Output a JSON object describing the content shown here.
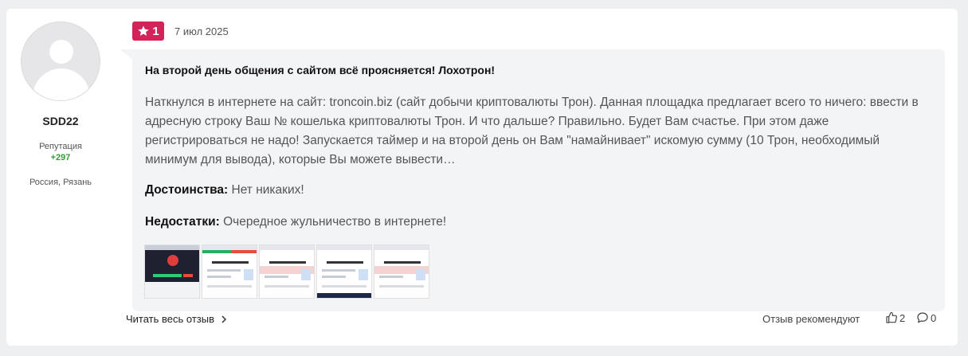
{
  "user": {
    "name": "SDD22",
    "reputation_label": "Репутация",
    "reputation_value": "+297",
    "location": "Россия, Рязань"
  },
  "review": {
    "rating": "1",
    "date": "7 июл 2025",
    "title": "На второй день общения с сайтом всё проясняется! Лохотрон!",
    "body": "Наткнулся в интернете на сайт: troncoin.biz (сайт добычи криптовалюты Трон). Данная площадка предлагает всего то ничего: ввести в адресную строку Ваш № кошелька криптовалюты Трон. И что дальше? Правильно. Будет Вам счастье. При этом даже регистрироваться не надо! Запускается таймер и на второй день он Вам \"намайнивает\" искомую сумму (10 Трон, необходимый минимум для вывода), которые Вы можете вывести…",
    "pros_label": "Достоинства:",
    "pros_text": "Нет никаких!",
    "cons_label": "Недостатки:",
    "cons_text": "Очередное жульничество в интернете!"
  },
  "footer": {
    "read_more": "Читать весь отзыв",
    "recommend_label": "Отзыв рекомендуют",
    "likes": "2",
    "comments": "0"
  },
  "icons": {
    "rating": "star-icon",
    "read_more": "chevron-right-icon",
    "likes": "thumbs-up-icon",
    "comments": "comment-icon"
  },
  "colors": {
    "rating_badge": "#d2235a",
    "reputation": "#3a9a3a"
  }
}
